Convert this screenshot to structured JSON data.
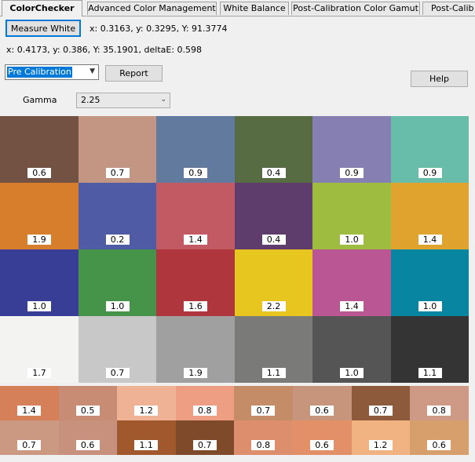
{
  "tabs": [
    "ColorChecker",
    "Advanced Color Management",
    "White Balance",
    "Post-Calibration Color Gamut",
    "Post-Calib"
  ],
  "toolbar": {
    "measure_white_label": "Measure White",
    "white_reading": "x: 0.3163, y: 0.3295, Y: 91.3774",
    "reading": "x: 0.4173, y: 0.386, Y: 35.1901, deltaE: 0.598",
    "mode_select_value": "Pre Calibration",
    "report_label": "Report",
    "help_label": "Help",
    "gamma_label": "Gamma",
    "gamma_value": "2.25"
  },
  "checker": {
    "rows": [
      [
        {
          "color": "#735244",
          "value": "0.6"
        },
        {
          "color": "#c29682",
          "value": "0.7"
        },
        {
          "color": "#627a9d",
          "value": "0.9"
        },
        {
          "color": "#576c43",
          "value": "0.4"
        },
        {
          "color": "#8580b1",
          "value": "0.9"
        },
        {
          "color": "#67bdaa",
          "value": "0.9"
        }
      ],
      [
        {
          "color": "#d67e2c",
          "value": "1.9"
        },
        {
          "color": "#505ba6",
          "value": "0.2"
        },
        {
          "color": "#c15a63",
          "value": "1.4"
        },
        {
          "color": "#5e3c6c",
          "value": "0.4"
        },
        {
          "color": "#9dbc40",
          "value": "1.0"
        },
        {
          "color": "#e0a32e",
          "value": "1.4"
        }
      ],
      [
        {
          "color": "#383d96",
          "value": "1.0"
        },
        {
          "color": "#469449",
          "value": "1.0"
        },
        {
          "color": "#af363c",
          "value": "1.6"
        },
        {
          "color": "#e7c71f",
          "value": "2.2"
        },
        {
          "color": "#bb5695",
          "value": "1.4"
        },
        {
          "color": "#0885a1",
          "value": "1.0"
        }
      ],
      [
        {
          "color": "#f3f3f2",
          "value": "1.7"
        },
        {
          "color": "#c8c8c8",
          "value": "0.7"
        },
        {
          "color": "#a0a0a0",
          "value": "1.9"
        },
        {
          "color": "#7a7a79",
          "value": "1.1"
        },
        {
          "color": "#555555",
          "value": "1.0"
        },
        {
          "color": "#343434",
          "value": "1.1"
        }
      ]
    ]
  },
  "skin": {
    "rows": [
      [
        {
          "color": "#d6805a",
          "value": "1.4"
        },
        {
          "color": "#c88b73",
          "value": "0.5"
        },
        {
          "color": "#f0b294",
          "value": "1.2"
        },
        {
          "color": "#ee9e83",
          "value": "0.8"
        },
        {
          "color": "#c58c68",
          "value": "0.7"
        },
        {
          "color": "#c7947c",
          "value": "0.6"
        },
        {
          "color": "#8d5b3c",
          "value": "0.7"
        },
        {
          "color": "#cf9a85",
          "value": "0.8"
        }
      ],
      [
        {
          "color": "#cb9882",
          "value": "0.7"
        },
        {
          "color": "#c8917d",
          "value": "0.6"
        },
        {
          "color": "#a0582c",
          "value": "1.1"
        },
        {
          "color": "#7f4a2a",
          "value": "0.7"
        },
        {
          "color": "#dd8e6c",
          "value": "0.8"
        },
        {
          "color": "#e38f68",
          "value": "0.6"
        },
        {
          "color": "#f0b381",
          "value": "1.2"
        },
        {
          "color": "#d79f6c",
          "value": "0.6"
        }
      ]
    ]
  }
}
